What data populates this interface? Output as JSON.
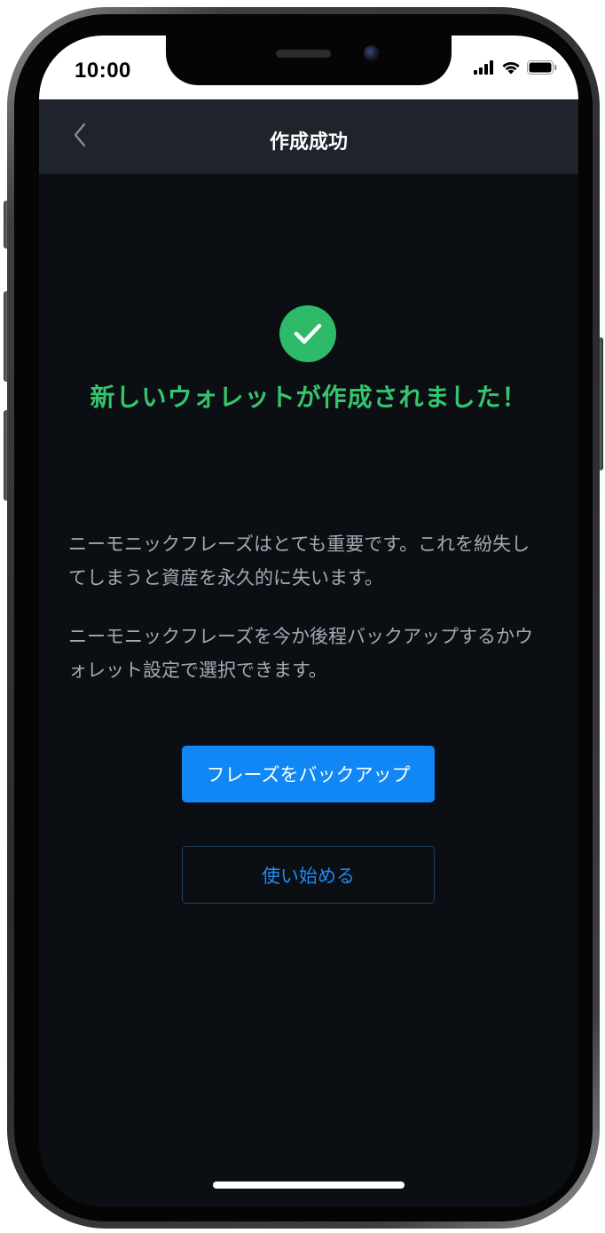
{
  "status_bar": {
    "time": "10:00",
    "icons": [
      "signal-icon",
      "wifi-icon",
      "battery-icon"
    ]
  },
  "nav": {
    "back_icon": "chevron-left-icon",
    "title": "作成成功"
  },
  "success": {
    "icon": "check-circle-icon",
    "title": "新しいウォレットが作成されました！"
  },
  "body": {
    "paragraph_1": "ニーモニックフレーズはとても重要です。これを紛失してしまうと資産を永久的に失います。",
    "paragraph_2": "ニーモニックフレーズを今か後程バックアップするかウォレット設定で選択できます。"
  },
  "actions": {
    "backup_label": "フレーズをバックアップ",
    "start_label": "使い始める"
  },
  "colors": {
    "background": "#0b0e12",
    "nav_background": "#1e232c",
    "success_green": "#35c46e",
    "primary_blue": "#1187f5"
  }
}
